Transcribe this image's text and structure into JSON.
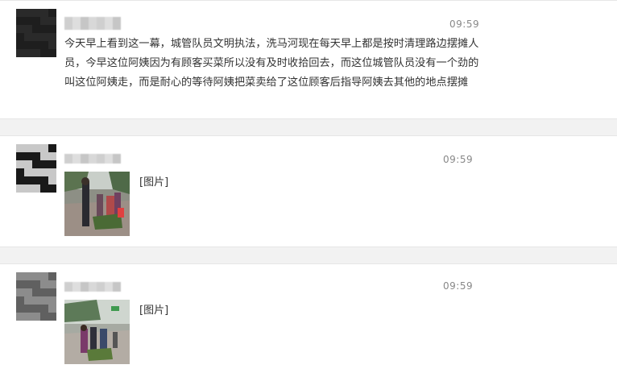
{
  "messages": [
    {
      "time": "09:59",
      "text": "今天早上看到这一幕，城管队员文明执法，洗马河现在每天早上都是按时清理路边摆摊人员，今早这位阿姨因为有顾客买菜所以没有及时收拾回去，而这位城管队员没有一个劲的叫这位阿姨走，而是耐心的等待阿姨把菜卖给了这位顾客后指导阿姨去其他的地点摆摊"
    },
    {
      "time": "09:59",
      "image_label": "[图片]"
    },
    {
      "time": "09:59",
      "image_label": "[图片]"
    }
  ],
  "colors": {
    "background": "#f2f2f2",
    "card": "#ffffff",
    "text": "#333333",
    "time": "#888888"
  }
}
